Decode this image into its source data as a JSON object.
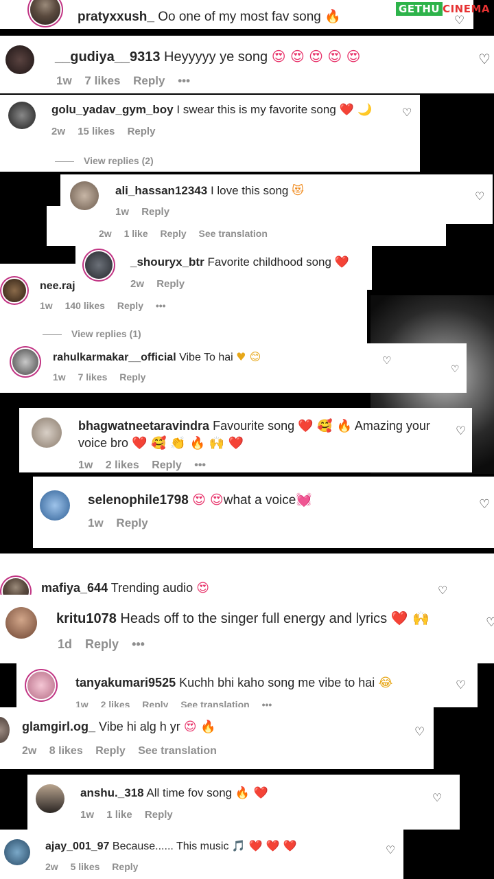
{
  "watermark": {
    "part1": "GETHU",
    "part2": "CINEMA"
  },
  "comments": [
    {
      "id": "c1",
      "user": "pratyxxush_",
      "text": "Oo one of my most fav song",
      "emoji": "🔥",
      "meta": []
    },
    {
      "id": "c2",
      "user": "__gudiya__9313",
      "text": "Heyyyyy ye song",
      "emoji": "😍 😍 😍 😍 😍",
      "meta": [
        "1w",
        "7 likes",
        "Reply",
        "•••"
      ]
    },
    {
      "id": "c3",
      "user": "golu_yadav_gym_boy",
      "text": "I swear this is my favorite song",
      "emoji": "❤️ 🌙",
      "meta": [
        "2w",
        "15 likes",
        "Reply"
      ],
      "replies": "View replies (2)"
    },
    {
      "id": "c4",
      "user": "ali_hassan12343",
      "text": "I love this song",
      "emoji": "😻",
      "meta": [
        "1w",
        "Reply"
      ]
    },
    {
      "id": "c4b",
      "meta": [
        "2w",
        "1 like",
        "Reply",
        "See translation"
      ]
    },
    {
      "id": "c5",
      "user": "_shouryx_btr",
      "text": "Favorite childhood song",
      "emoji": "❤️",
      "meta": [
        "2w",
        "Reply"
      ]
    },
    {
      "id": "c6",
      "user": "nee.raj.",
      "text": "",
      "emoji": "",
      "meta": [
        "1w",
        "140 likes",
        "Reply",
        "•••"
      ],
      "replies": "View replies (1)"
    },
    {
      "id": "c7",
      "user": "rahulkarmakar__official",
      "text": "Vibe To hai",
      "emoji": "♥ 😊",
      "meta": [
        "1w",
        "7 likes",
        "Reply"
      ]
    },
    {
      "id": "c8",
      "user": "bhagwatneetaravindra",
      "text": "Favourite song",
      "emoji": "❤️ 🥰 🔥",
      "text2": "Amazing your",
      "line2": "voice bro",
      "emoji2": "❤️ 🥰 👏 🔥 🙌 ❤️",
      "meta": [
        "1w",
        "2 likes",
        "Reply",
        "•••"
      ]
    },
    {
      "id": "c9",
      "user": "selenophile1798",
      "text": "what a voice",
      "emoji1": "😍 😍",
      "emoji": "💓",
      "meta": [
        "1w",
        "Reply"
      ]
    },
    {
      "id": "c10",
      "user": "mafiya_644",
      "text": "Trending audio",
      "emoji": "😍",
      "meta": []
    },
    {
      "id": "c11",
      "user": "kritu1078",
      "text": "Heads off to the singer full energy and lyrics",
      "emoji": "❤️ 🙌",
      "meta": [
        "1d",
        "Reply",
        "•••"
      ]
    },
    {
      "id": "c12",
      "user": "tanyakumari9525",
      "text": "Kuchh bhi kaho song me vibe to hai",
      "emoji": "😂",
      "meta": [
        "1w",
        "2 likes",
        "Reply",
        "See translation",
        "•••"
      ]
    },
    {
      "id": "c13",
      "user": "glamgirl.og_",
      "text": "Vibe hi alg h yr",
      "emoji": "😍 🔥",
      "meta": [
        "2w",
        "8 likes",
        "Reply",
        "See translation"
      ]
    },
    {
      "id": "c14",
      "user": "anshu._318",
      "text": "All time fov song",
      "emoji": "🔥 ❤️",
      "meta": [
        "1w",
        "1 like",
        "Reply"
      ]
    },
    {
      "id": "c15",
      "user": "ajay_001_97",
      "text": "Because...... This music",
      "emoji": "🎵 ❤️ ❤️ ❤️",
      "meta": [
        "2w",
        "5 likes",
        "Reply"
      ]
    }
  ]
}
